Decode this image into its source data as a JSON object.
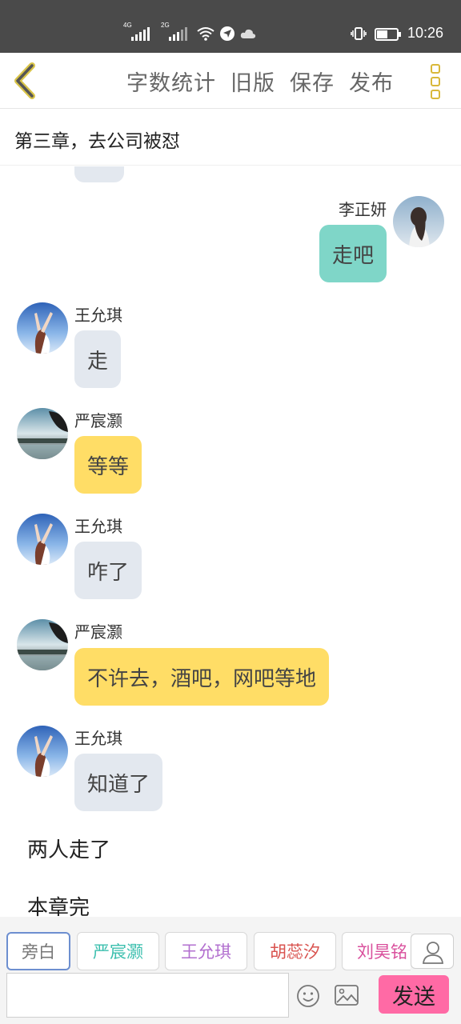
{
  "status_bar": {
    "network_1": "4G",
    "network_2": "2G",
    "time": "10:26",
    "battery_level": 0.55
  },
  "toolbar": {
    "word_count_label": "字数统计",
    "old_version_label": "旧版",
    "save_label": "保存",
    "publish_label": "发布"
  },
  "chapter": {
    "title": "第三章，去公司被怼"
  },
  "messages": [
    {
      "sender": "李正妍",
      "text": "走吧"
    },
    {
      "sender": "王允琪",
      "text": "走"
    },
    {
      "sender": "严宸灏",
      "text": "等等"
    },
    {
      "sender": "王允琪",
      "text": "咋了"
    },
    {
      "sender": "严宸灏",
      "text": "不许去，酒吧，网吧等地"
    },
    {
      "sender": "王允琪",
      "text": "知道了"
    }
  ],
  "narrations": [
    "两人走了",
    "本章完"
  ],
  "characters": [
    "旁白",
    "严宸灏",
    "王允琪",
    "胡蕊汐",
    "刘昊铭"
  ],
  "character_colors": [
    "#777777",
    "#3bbfae",
    "#b26fcf",
    "#d9534f",
    "#d94f9c"
  ],
  "composer": {
    "input_value": "",
    "send_label": "发送"
  },
  "colors": {
    "teal_bubble": "#7fd6c8",
    "yellow_bubble": "#ffdd66",
    "gray_bubble": "#e3e8ef",
    "send_button": "#ff6aa5"
  }
}
